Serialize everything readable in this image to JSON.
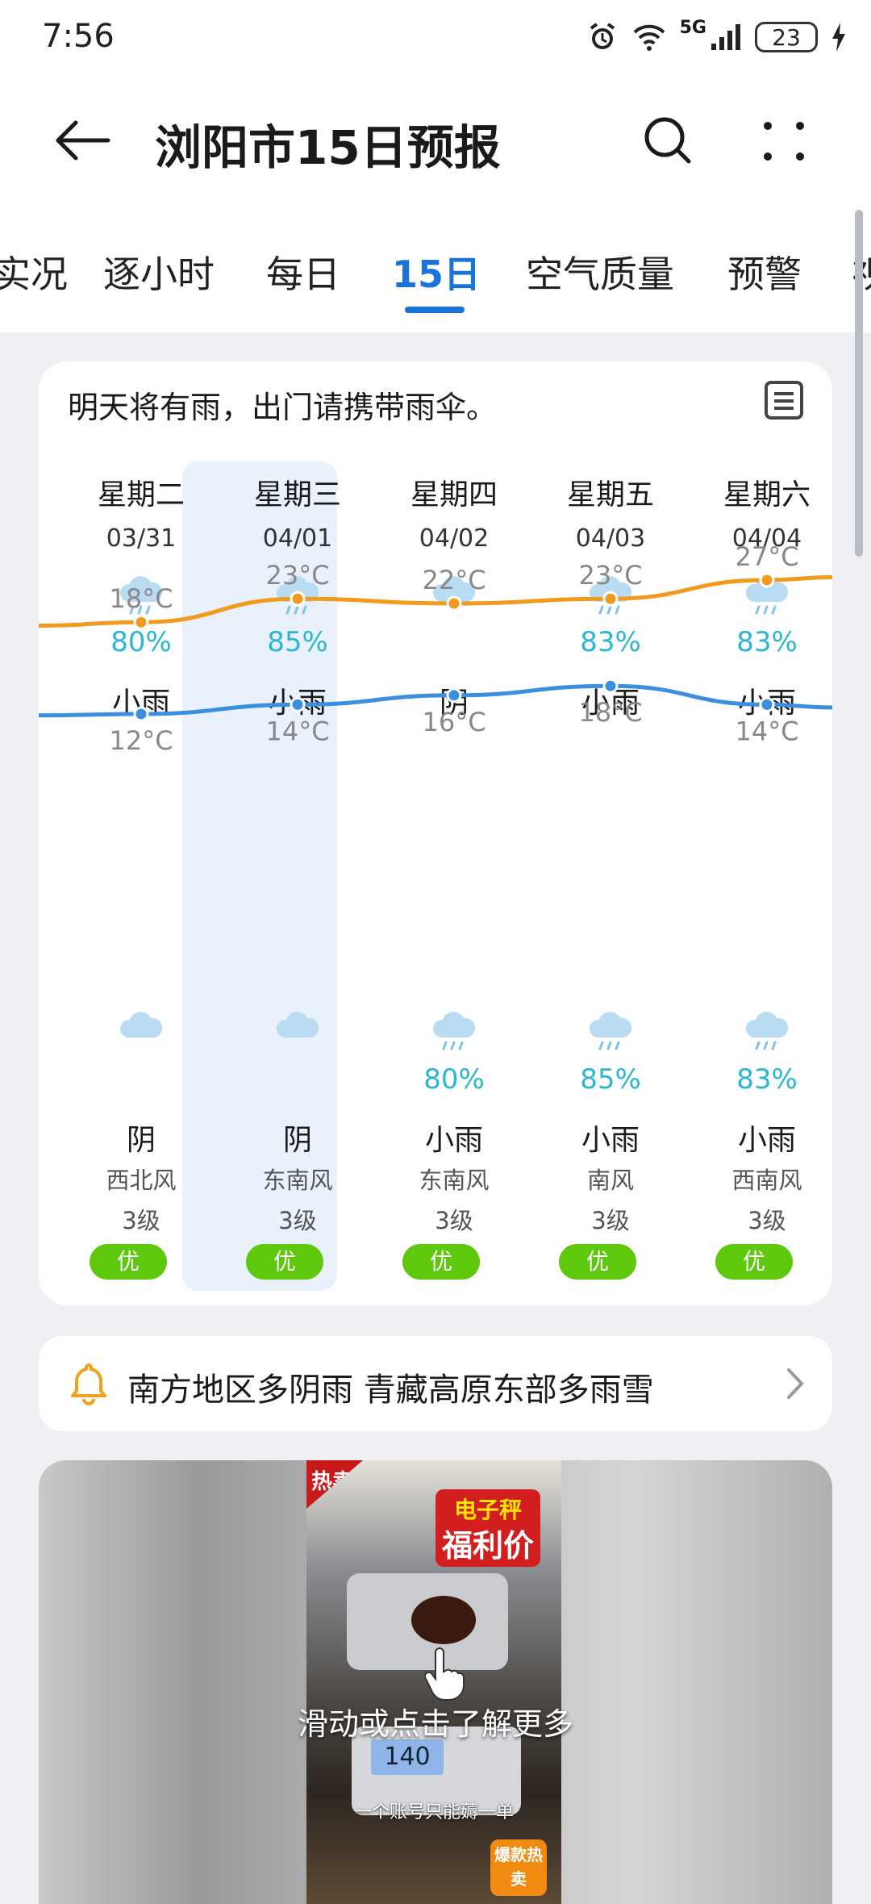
{
  "status_bar": {
    "time": "7:56",
    "network": "5G",
    "battery": "23"
  },
  "header": {
    "title": "浏阳市15日预报"
  },
  "tabs": [
    {
      "label": "实况"
    },
    {
      "label": "逐小时"
    },
    {
      "label": "每日"
    },
    {
      "label": "15日",
      "active": true
    },
    {
      "label": "空气质量"
    },
    {
      "label": "预警"
    },
    {
      "label": "视"
    }
  ],
  "forecast": {
    "summary": "明天将有雨，出门请携带雨伞。",
    "days": [
      {
        "weekday": "星期二",
        "date": "03/31",
        "day_icon": "rain-cloud-icon",
        "day_prob": "80%",
        "day_cond": "小雨",
        "high": "18°C",
        "low": "12°C",
        "night_icon": "cloud-icon",
        "night_prob": "",
        "night_cond": "阴",
        "wind": "西北风",
        "level": "3级",
        "aqi": "优"
      },
      {
        "weekday": "星期三",
        "date": "04/01",
        "day_icon": "rain-cloud-icon",
        "day_prob": "85%",
        "day_cond": "小雨",
        "high": "23°C",
        "low": "14°C",
        "night_icon": "cloud-icon",
        "night_prob": "",
        "night_cond": "阴",
        "wind": "东南风",
        "level": "3级",
        "aqi": "优"
      },
      {
        "weekday": "星期四",
        "date": "04/02",
        "day_icon": "cloud-icon",
        "day_prob": "",
        "day_cond": "阴",
        "high": "22°C",
        "low": "16°C",
        "night_icon": "rain-cloud-icon",
        "night_prob": "80%",
        "night_cond": "小雨",
        "wind": "东南风",
        "level": "3级",
        "aqi": "优"
      },
      {
        "weekday": "星期五",
        "date": "04/03",
        "day_icon": "rain-cloud-icon",
        "day_prob": "83%",
        "day_cond": "小雨",
        "high": "23°C",
        "low": "18°C",
        "night_icon": "rain-cloud-icon",
        "night_prob": "85%",
        "night_cond": "小雨",
        "wind": "南风",
        "level": "3级",
        "aqi": "优"
      },
      {
        "weekday": "星期六",
        "date": "04/04",
        "day_icon": "rain-cloud-icon",
        "day_prob": "83%",
        "day_cond": "小雨",
        "high": "27°C",
        "low": "14°C",
        "night_icon": "rain-cloud-icon",
        "night_prob": "83%",
        "night_cond": "小雨",
        "wind": "西南风",
        "level": "3级",
        "aqi": "优"
      }
    ],
    "highlighted_day": "星期三"
  },
  "chart_data": {
    "type": "line",
    "categories": [
      "03/31",
      "04/01",
      "04/02",
      "04/03",
      "04/04"
    ],
    "series": [
      {
        "values": [
          18,
          23,
          22,
          23,
          27
        ],
        "color": "#f29a1c"
      },
      {
        "values": [
          12,
          14,
          16,
          18,
          14
        ],
        "color": "#3a8fe0"
      }
    ],
    "unit": "°C"
  },
  "news": {
    "text": "南方地区多阴雨 青藏高原东部多雨雪"
  },
  "ad": {
    "tag": "热卖",
    "badge_top": "电子秤",
    "badge_bottom": "福利价",
    "scale_reading": "140",
    "overlay": "滑动或点击了解更多",
    "caption": "一个账号只能薅一单",
    "hot": "爆款热卖"
  },
  "colors": {
    "accent": "#1a73d9",
    "rain": "#2bb7d1",
    "aqi_good": "#5dc80c",
    "high_line": "#f29a1c",
    "low_line": "#3a8fe0"
  }
}
